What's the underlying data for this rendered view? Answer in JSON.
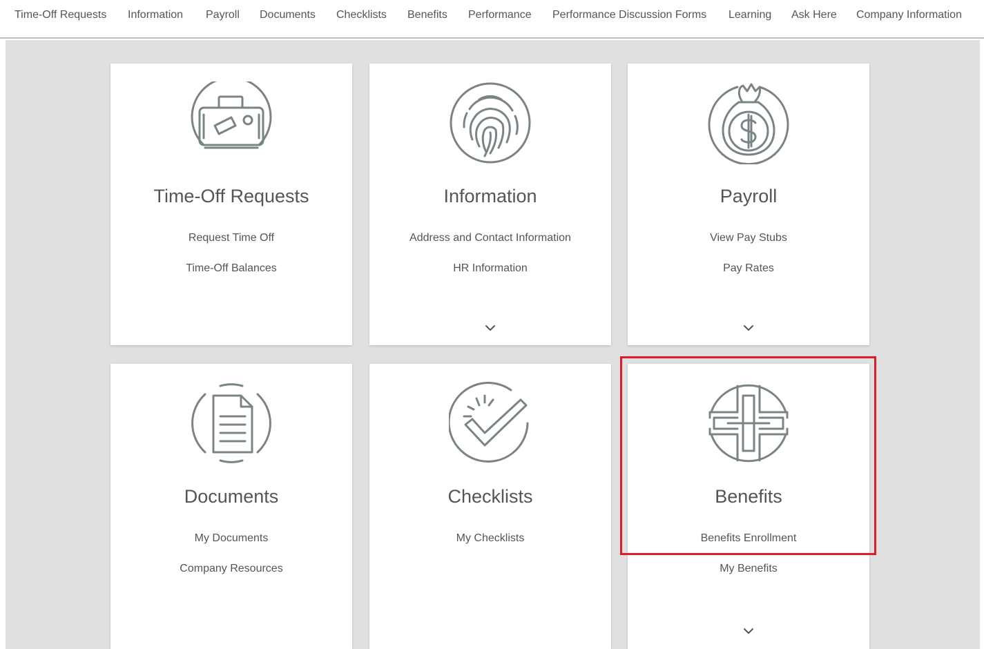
{
  "topnav": {
    "items": [
      {
        "label": "Time-Off Requests"
      },
      {
        "label": "Information"
      },
      {
        "label": "Payroll"
      },
      {
        "label": "Documents"
      },
      {
        "label": "Checklists"
      },
      {
        "label": "Benefits"
      },
      {
        "label": "Performance"
      },
      {
        "label": "Performance Discussion Forms"
      },
      {
        "label": "Learning"
      },
      {
        "label": "Ask Here"
      },
      {
        "label": "Company Information"
      }
    ]
  },
  "cards": [
    {
      "title": "Time-Off Requests",
      "icon": "briefcase-icon",
      "links": [
        "Request Time Off",
        "Time-Off Balances"
      ],
      "has_more": false
    },
    {
      "title": "Information",
      "icon": "fingerprint-icon",
      "links": [
        "Address and Contact Information",
        "HR Information"
      ],
      "has_more": true
    },
    {
      "title": "Payroll",
      "icon": "money-bag-icon",
      "links": [
        "View Pay Stubs",
        "Pay Rates"
      ],
      "has_more": true
    },
    {
      "title": "Documents",
      "icon": "document-icon",
      "links": [
        "My Documents",
        "Company Resources"
      ],
      "has_more": false
    },
    {
      "title": "Checklists",
      "icon": "checkmark-icon",
      "links": [
        "My Checklists"
      ],
      "has_more": false
    },
    {
      "title": "Benefits",
      "icon": "medical-cross-icon",
      "links": [
        "Benefits Enrollment",
        "My Benefits"
      ],
      "has_more": true
    }
  ],
  "colors": {
    "text": "#555555",
    "icon_stroke": "#7a8486",
    "background": "#e0e0e0",
    "card": "#ffffff",
    "highlight": "#e01e26"
  }
}
